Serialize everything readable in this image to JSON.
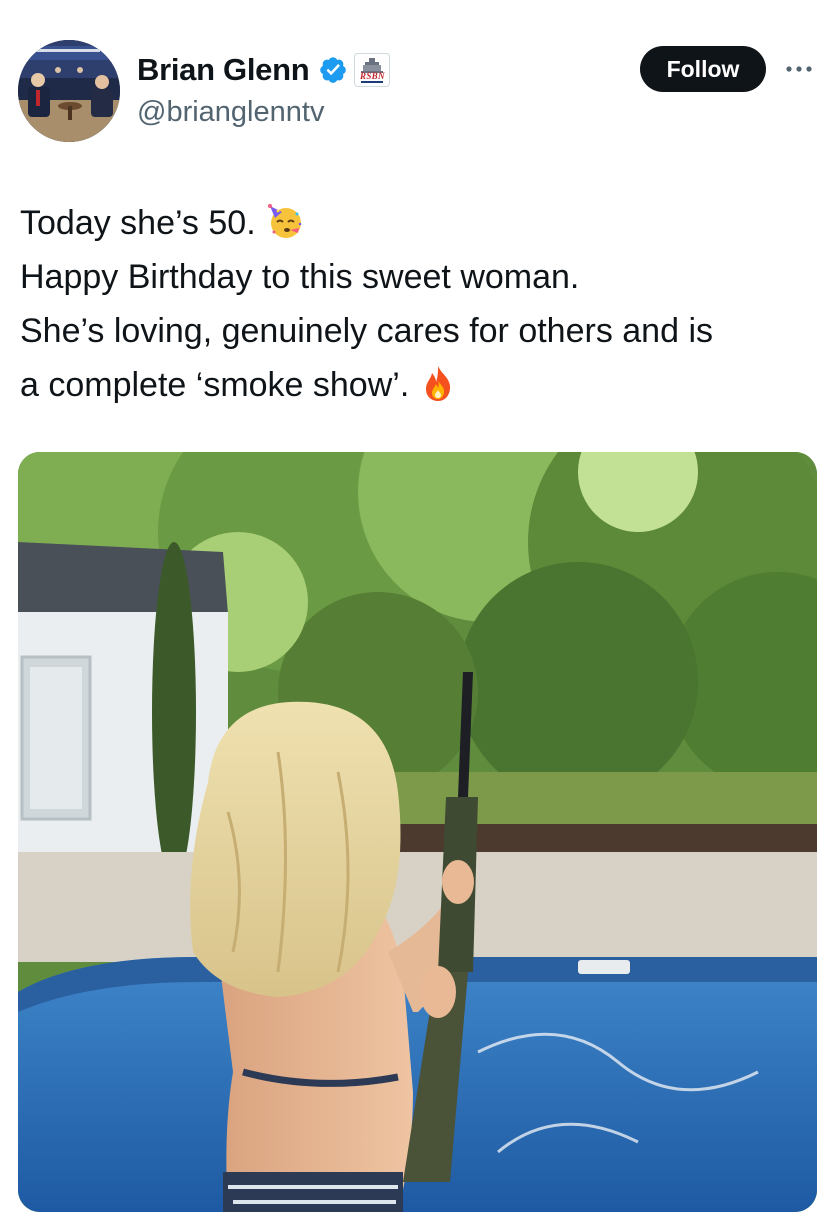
{
  "tweet": {
    "author": {
      "display_name": "Brian Glenn",
      "handle": "@brianglenntv",
      "verified_icon": "verified-badge-icon",
      "affiliation_badge": "RSBN"
    },
    "follow_label": "Follow",
    "more_icon": "more-horizontal-icon",
    "text_lines": [
      "Today she’s 50.",
      "Happy Birthday to this sweet woman.",
      "She’s loving, genuinely cares for others and is",
      "a complete ‘smoke show’."
    ],
    "emojis": {
      "line1": "partying-face-emoji",
      "line4": "fire-emoji"
    },
    "media": {
      "type": "photo"
    }
  },
  "colors": {
    "text_primary": "#0f1419",
    "text_secondary": "#536471",
    "follow_bg": "#0f1419",
    "verified_blue": "#1d9bf0"
  }
}
